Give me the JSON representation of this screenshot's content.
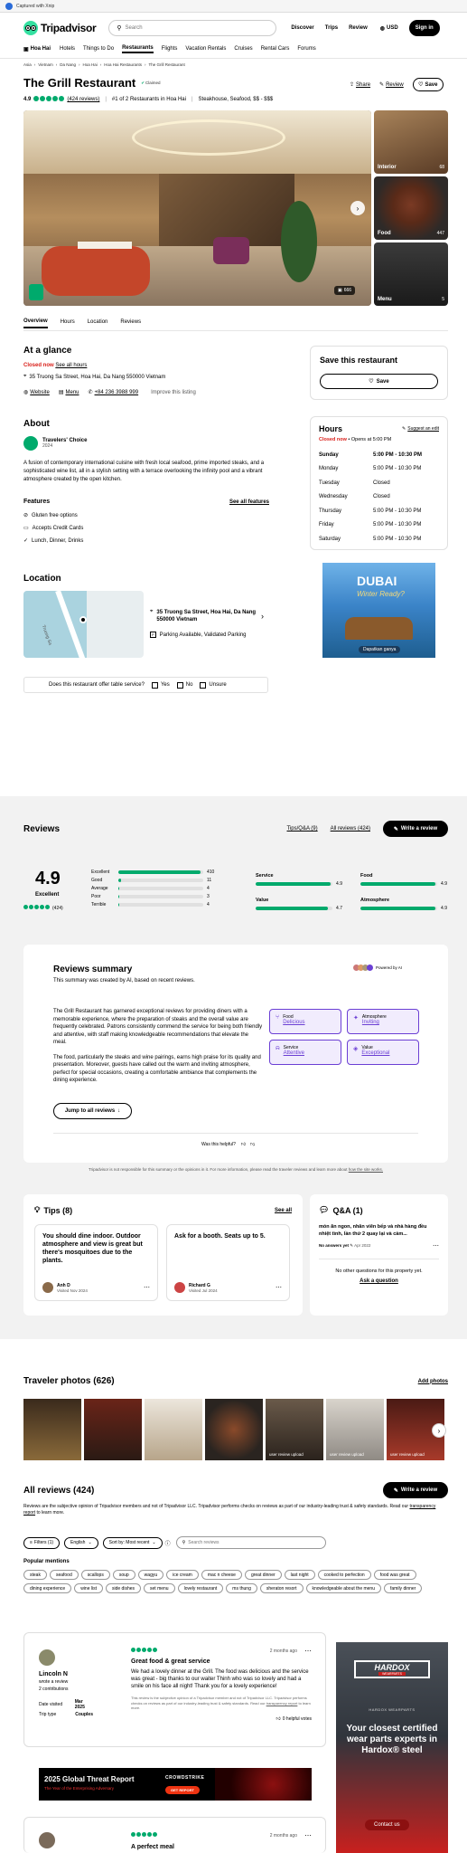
{
  "banner": {
    "text": "Captured with Xnip"
  },
  "header": {
    "logo": "Tripadvisor",
    "search_placeholder": "Search",
    "nav": [
      "Discover",
      "Trips",
      "Review"
    ],
    "currency": "USD",
    "signin": "Sign in"
  },
  "subnav": {
    "location": "Hoa Hai",
    "items": [
      "Hotels",
      "Things to Do",
      "Restaurants",
      "Flights",
      "Vacation Rentals",
      "Cruises",
      "Rental Cars",
      "Forums"
    ]
  },
  "breadcrumb": [
    "Asia",
    "Vietnam",
    "Da Nang",
    "Hoa Hai",
    "Hoa Hai Restaurants",
    "The Grill Restaurant"
  ],
  "restaurant": {
    "name": "The Grill Restaurant",
    "claimed": "Claimed",
    "share": "Share",
    "review": "Review",
    "save": "Save",
    "rating": "4.9",
    "reviews_link": "(424 reviews)",
    "rank": "#1 of 2 Restaurants in Hoa Hai",
    "cuisines": "Steakhouse, Seafood, $$ - $$$",
    "photo_count": "666",
    "side_photos": [
      {
        "label": "Interior",
        "count": "68"
      },
      {
        "label": "Food",
        "count": "447"
      },
      {
        "label": "Menu",
        "count": "5"
      }
    ]
  },
  "tabs": [
    "Overview",
    "Hours",
    "Location",
    "Reviews"
  ],
  "glance": {
    "title": "At a glance",
    "closed": "Closed now",
    "see_hours": "See all hours",
    "address": "35 Truong Sa Street, Hoa Hai, Da Nang 550000 Vietnam",
    "website": "Website",
    "menu": "Menu",
    "phone": "+84 236 3988 999",
    "improve": "Improve this listing"
  },
  "save_card": {
    "title": "Save this restaurant",
    "button": "Save"
  },
  "about": {
    "title": "About",
    "award": "Travelers' Choice",
    "award_year": "2024",
    "text": "A fusion of contemporary international cuisine with fresh local seafood, prime imported steaks, and a sophisticated wine list, all in a stylish setting with a terrace overlooking the infinity pool and a vibrant atmosphere created by the open kitchen."
  },
  "features": {
    "title": "Features",
    "see_all": "See all features",
    "items": [
      "Gluten free options",
      "Accepts Credit Cards",
      "Lunch, Dinner, Drinks"
    ]
  },
  "hours": {
    "title": "Hours",
    "suggest": "Suggest an edit",
    "status": "Closed now",
    "opens": " • Opens at 5:00 PM",
    "rows": [
      {
        "day": "Sunday",
        "time": "5:00 PM - 10:30 PM"
      },
      {
        "day": "Monday",
        "time": "5:00 PM - 10:30 PM"
      },
      {
        "day": "Tuesday",
        "time": "Closed"
      },
      {
        "day": "Wednesday",
        "time": "Closed"
      },
      {
        "day": "Thursday",
        "time": "5:00 PM - 10:30 PM"
      },
      {
        "day": "Friday",
        "time": "5:00 PM - 10:30 PM"
      },
      {
        "day": "Saturday",
        "time": "5:00 PM - 10:30 PM"
      }
    ]
  },
  "location": {
    "title": "Location",
    "address": "35 Truong Sa Street, Hoa Hai, Da Nang 550000 Vietnam",
    "parking": "Parking Available, Validated Parking",
    "street_label": "Truong Sa"
  },
  "ad1": {
    "title": "DUBAI",
    "subtitle": "Winter Ready?",
    "cta": "Dapatkan ganya"
  },
  "table_service": {
    "question": "Does this restaurant offer table service?",
    "options": [
      "Yes",
      "No",
      "Unsure"
    ]
  },
  "reviews": {
    "title": "Reviews",
    "tips_link": "Tips/Q&A (9)",
    "all_link": "All reviews (424)",
    "write": "Write a review",
    "score": "4.9",
    "score_label": "Excellent",
    "count": "(424)",
    "bars": [
      {
        "label": "Excellent",
        "value": 410,
        "pct": 0.97
      },
      {
        "label": "Good",
        "value": 11,
        "pct": 0.03
      },
      {
        "label": "Average",
        "value": 4,
        "pct": 0.01
      },
      {
        "label": "Poor",
        "value": 3,
        "pct": 0.01
      },
      {
        "label": "Terrible",
        "value": 4,
        "pct": 0.01
      }
    ],
    "sub": [
      {
        "label": "Service",
        "value": "4.9",
        "pct": 0.98
      },
      {
        "label": "Food",
        "value": "4.9",
        "pct": 0.98
      },
      {
        "label": "Value",
        "value": "4.7",
        "pct": 0.94
      },
      {
        "label": "Atmosphere",
        "value": "4.9",
        "pct": 0.98
      }
    ]
  },
  "summary": {
    "title": "Reviews summary",
    "powered": "Powered by AI",
    "created": "This summary was created by AI, based on recent reviews.",
    "p1": "The Grill Restaurant has garnered exceptional reviews for providing diners with a memorable experience, where the preparation of steaks and the overall value are frequently celebrated. Patrons consistently commend the service for being both friendly and attentive, with staff making knowledgeable recommendations that elevate the meal.",
    "p2": "The food, particularly the steaks and wine pairings, earns high praise for its quality and presentation. Moreover, guests have called out the warm and inviting atmosphere, perfect for special occasions, creating a comfortable ambiance that complements the dining experience.",
    "jump": "Jump to all reviews",
    "tags": [
      {
        "k": "Food",
        "v": "Delicious"
      },
      {
        "k": "Atmosphere",
        "v": "Inviting"
      },
      {
        "k": "Service",
        "v": "Attentive"
      },
      {
        "k": "Value",
        "v": "Exceptional"
      }
    ],
    "helpful": "Was this helpful?",
    "disclaimer": "Tripadvisor is not responsible for this summary or the opinions in it. For more information, please read the traveler reviews and learn more about",
    "disclaimer_link": "how the site works."
  },
  "tips": {
    "title": "Tips (8)",
    "see_all": "See all",
    "items": [
      {
        "text": "You should dine indoor. Outdoor atmosphere and view is great but there's mosquitoes due to the plants.",
        "name": "Anh D",
        "date": "Visited Nov 2024"
      },
      {
        "text": "Ask for a booth. Seats up to 5.",
        "name": "Richard G",
        "date": "Visited Jul 2024"
      }
    ]
  },
  "qa": {
    "title": "Q&A (1)",
    "question": "món ăn ngon, nhân viên bếp và nhà hàng đều nhiệt tình, lần thứ 2 quay lại và cảm...",
    "no_answer": "No answers yet",
    "date": "Apr 2022",
    "other": "No other questions for this property yet.",
    "ask": "Ask a question"
  },
  "photos": {
    "title": "Traveler photos (626)",
    "add": "Add photos",
    "tiles": [
      "",
      "",
      "",
      "",
      "user review upload",
      "user review upload",
      "user review upload"
    ]
  },
  "all_reviews": {
    "title": "All reviews (424)",
    "write": "Write a review",
    "disclaimer": "Reviews are the subjective opinion of Tripadvisor members and not of Tripadvisor LLC. Tripadvisor performs checks on reviews as part of our industry-leading trust & safety standards. Read our",
    "disclaimer_link": "transparency report",
    "disclaimer_end": "to learn more.",
    "filter": "Filters (1)",
    "language": "English",
    "sort": "Sort by: Most recent",
    "search_placeholder": "Search reviews",
    "mentions_title": "Popular mentions",
    "mentions": [
      "steak",
      "seafood",
      "scallops",
      "soup",
      "wagyu",
      "ice cream",
      "mac n cheese",
      "great dinner",
      "last night",
      "cooked to perfection",
      "food was great",
      "dining experience",
      "wine list",
      "side dishes",
      "set menu",
      "lovely restaurant",
      "ms thung",
      "sheraton resort",
      "knowledgeable about the menu",
      "family dinner"
    ]
  },
  "review1": {
    "name": "Lincoln N",
    "contrib1": "wrote a review",
    "contrib2": "2 contributions",
    "date_label": "Date visited",
    "date": "Mar 2025",
    "trip_label": "Trip type",
    "trip": "Couples",
    "ago": "2 months ago",
    "title": "Great food & great service",
    "text": "We had a lovely dinner at the Grill. The food was delicious and the service was great - big thanks to our waiter Thinh who was so lovely and had a smile on his face all night! Thank you for a lovely experience!",
    "fine": "This review is the subjective opinion of a Tripadvisor member and not of Tripadvisor LLC. Tripadvisor performs checks on reviews as part of our industry-leading trust & safety standards. Read our",
    "fine_link": "transparency report",
    "fine_end": "to learn more.",
    "helpful": "0 helpful votes"
  },
  "ad2": {
    "title": "2025 Global Threat Report",
    "subtitle": "The Year of the Enterprising Adversary",
    "brand": "CROWDSTRIKE",
    "cta": "GET REPORT"
  },
  "ad3": {
    "brand": "HARDOX",
    "sub": "WEARPARTS",
    "tag": "HARDOX WEARPARTS",
    "text": "Your closest certified wear parts experts in Hardox® steel",
    "cta": "Contact us"
  },
  "review2": {
    "ago": "2 months ago",
    "title": "A perfect meal"
  },
  "colors": {
    "brand_green": "#00aa6c",
    "black": "#000000",
    "closed_red": "#d91e18",
    "ai_purple": "#6b3fd4"
  }
}
